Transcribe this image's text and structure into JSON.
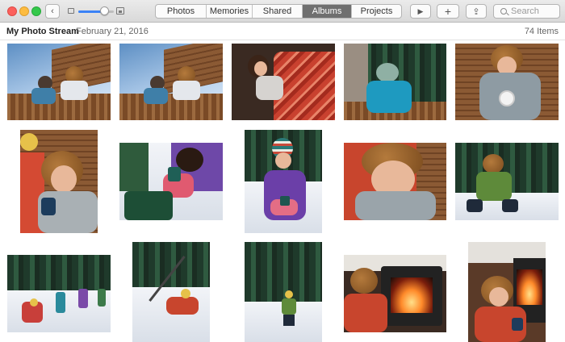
{
  "toolbar": {
    "back_symbol": "‹",
    "tabs": [
      "Photos",
      "Memories",
      "Shared",
      "Albums",
      "Projects"
    ],
    "active_tab": "Albums",
    "play_symbol": "▶",
    "add_symbol": "+",
    "share_symbol": "⇪",
    "search_placeholder": "Search",
    "zoom_level": 0.7
  },
  "header": {
    "album_name": "My Photo Stream",
    "date": "February 21, 2016",
    "item_count": "74 Items"
  },
  "colors": {
    "accent": "#3b82f6",
    "active_tab_bg": "#6f6f6f",
    "close": "#fc605c",
    "minimize": "#fdbc40",
    "zoom": "#34c84a"
  },
  "icons": [
    "back-arrow-icon",
    "zoom-out-icon",
    "zoom-in-icon",
    "play-icon",
    "add-icon",
    "share-icon",
    "search-icon"
  ]
}
